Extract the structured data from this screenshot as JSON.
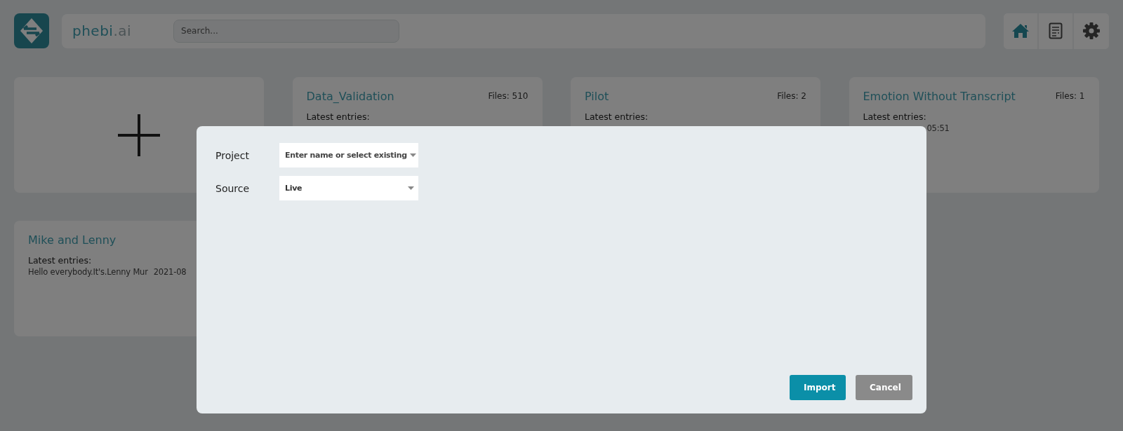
{
  "header": {
    "brand": "phebi",
    "brand_suffix": ".ai",
    "search": {
      "placeholder": "Search..."
    },
    "nav": [
      {
        "kind": "home",
        "selected": true
      },
      {
        "kind": "document",
        "selected": false
      },
      {
        "kind": "settings",
        "selected": false
      }
    ]
  },
  "projects": [
    {
      "kind": "new"
    },
    {
      "kind": "project",
      "title": "Data_Validation",
      "files": "Files: 510",
      "latest_label": "Latest entries:"
    },
    {
      "kind": "project",
      "title": "Pilot",
      "files": "Files: 2",
      "latest_label": "Latest entries:"
    },
    {
      "kind": "project",
      "title": "Emotion Without Transcript",
      "files": "Files: 1",
      "latest_label": "Latest entries:",
      "entry": {
        "time": "05:51"
      }
    },
    {
      "kind": "project",
      "title": "Mike and Lenny",
      "latest_label": "Latest entries:",
      "entry": {
        "text": "Hello everybody.It's.Lenny Mur",
        "time": "2021-08"
      }
    }
  ],
  "dialog": {
    "fields": [
      {
        "label": "Project",
        "placeholder": "Enter name or select existing"
      },
      {
        "label": "Source",
        "value": "Live"
      }
    ],
    "buttons": [
      {
        "label": "Import",
        "kind": "primary"
      },
      {
        "label": "Cancel",
        "kind": "secondary"
      }
    ]
  }
}
